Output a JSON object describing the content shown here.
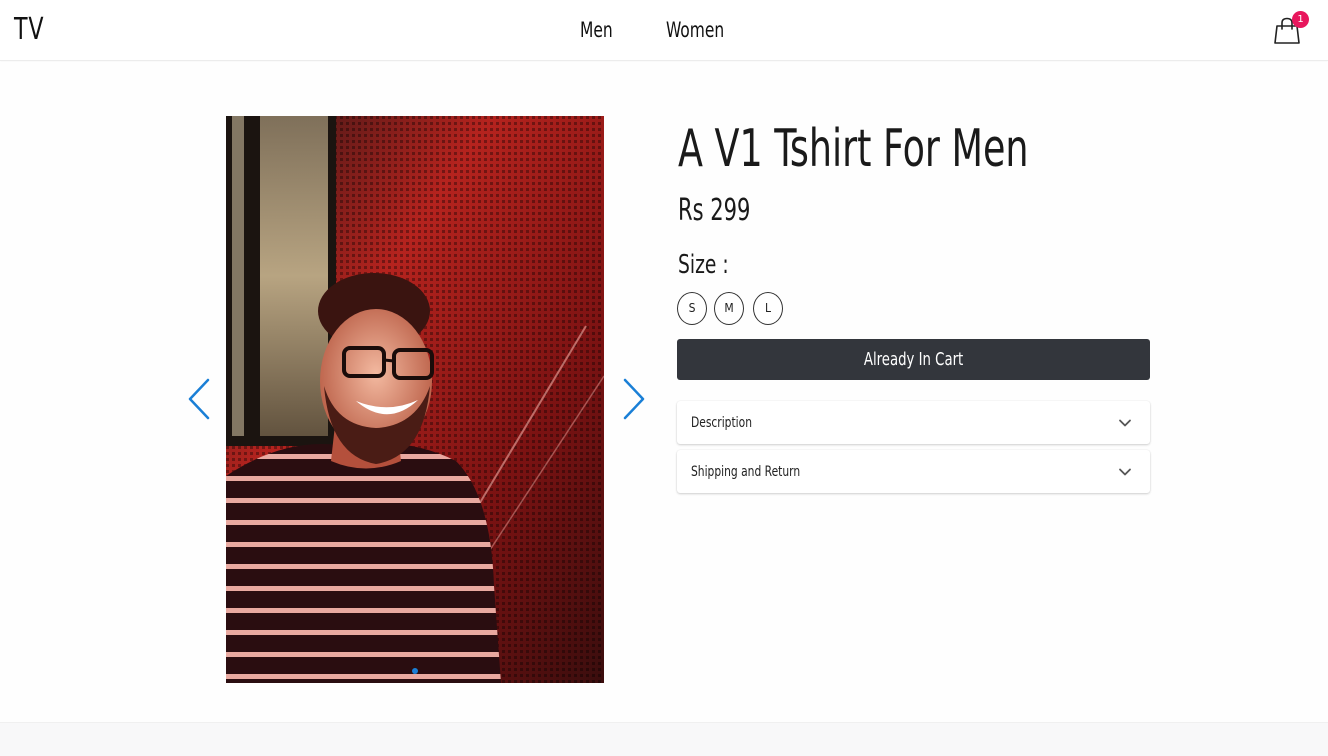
{
  "header": {
    "logo": "TV",
    "nav": [
      {
        "label": "Men"
      },
      {
        "label": "Women"
      }
    ],
    "cart_count": "1",
    "accent_color": "#e8175d"
  },
  "product": {
    "title": "A V1 Tshirt For Men",
    "price": "Rs 299",
    "size_label": "Size :",
    "sizes": [
      "S",
      "M",
      "L"
    ],
    "cart_button_label": "Already In Cart",
    "carousel_active_index": 0
  },
  "accordions": [
    {
      "label": "Description",
      "icon": "chevron-down-icon"
    },
    {
      "label": "Shipping and Return",
      "icon": "chevron-down-icon"
    }
  ],
  "colors": {
    "button_bg": "#33363c",
    "arrow": "#1a7fd6"
  }
}
